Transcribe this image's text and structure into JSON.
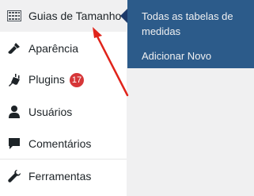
{
  "sidebar": {
    "items": [
      {
        "label": "Guias de Tamanho",
        "icon": "table-icon",
        "active": true
      },
      {
        "label": "Aparência",
        "icon": "paintbrush-icon"
      },
      {
        "label": "Plugins",
        "icon": "plugin-icon",
        "badge": "17"
      },
      {
        "label": "Usuários",
        "icon": "user-icon"
      },
      {
        "label": "Comentários",
        "icon": "comment-icon"
      },
      {
        "label": "Ferramentas",
        "icon": "wrench-icon"
      }
    ]
  },
  "flyout": {
    "items": [
      {
        "label": "Todas as tabelas de medidas"
      },
      {
        "label": "Adicionar Novo"
      }
    ]
  },
  "colors": {
    "flyout_bg": "#2c5b8a",
    "badge_bg": "#d63638",
    "annotation_arrow": "#e0241b",
    "icon": "#1d2327"
  }
}
